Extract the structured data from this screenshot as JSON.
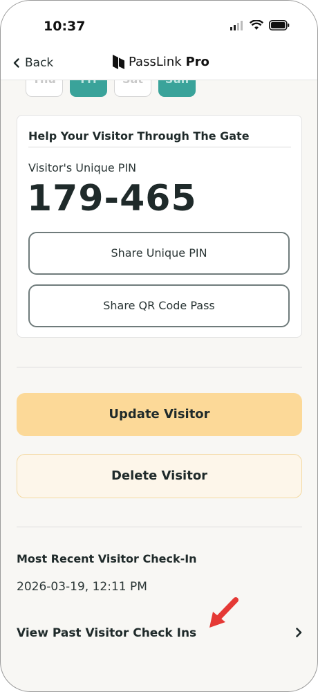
{
  "status_bar": {
    "time": "10:37"
  },
  "nav": {
    "back_label": "Back",
    "brand_name": "PassLink",
    "brand_suffix": "Pro"
  },
  "days": [
    {
      "label": "Thu",
      "selected": false
    },
    {
      "label": "Fri",
      "selected": true
    },
    {
      "label": "Sat",
      "selected": false
    },
    {
      "label": "Sun",
      "selected": true
    }
  ],
  "pin_card": {
    "title": "Help Your Visitor Through The Gate",
    "pin_label": "Visitor's Unique PIN",
    "pin_value": "179-465",
    "share_pin_label": "Share Unique PIN",
    "share_qr_label": "Share QR Code Pass"
  },
  "actions": {
    "update_label": "Update Visitor",
    "delete_label": "Delete Visitor"
  },
  "recent": {
    "title": "Most Recent Visitor Check-In",
    "value": "2026-03-19, 12:11 PM",
    "past_link_label": "View Past Visitor Check Ins"
  },
  "colors": {
    "accent_teal": "#3aa39a",
    "update_bg": "#fcd998",
    "delete_bg": "#fdf6ea",
    "annotation": "#e53935"
  },
  "icons": [
    "signal-icon",
    "wifi-icon",
    "battery-icon",
    "back-chevron-icon",
    "passlink-logo-icon",
    "chevron-right-icon",
    "annotation-arrow-icon"
  ]
}
